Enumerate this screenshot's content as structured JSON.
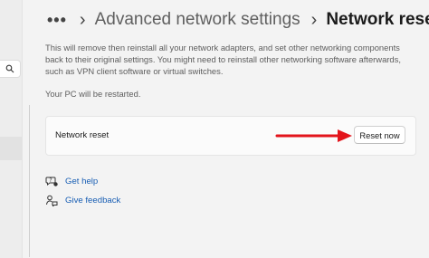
{
  "breadcrumb": {
    "more": "•••",
    "parent": "Advanced network settings",
    "separator": "›",
    "current": "Network reset"
  },
  "description": "This will remove then reinstall all your network adapters, and set other networking components back to their original settings. You might need to reinstall other networking software afterwards, such as VPN client software or virtual switches.",
  "restart_note": "Your PC will be restarted.",
  "card": {
    "label": "Network reset",
    "button_label": "Reset now"
  },
  "links": {
    "help": "Get help",
    "feedback": "Give feedback"
  },
  "colors": {
    "annotation_arrow": "#e3141b",
    "link": "#1a5fb4"
  },
  "icons": {
    "search": "search-icon",
    "help": "help-icon",
    "feedback": "feedback-icon",
    "arrow": "red-arrow-annotation"
  }
}
